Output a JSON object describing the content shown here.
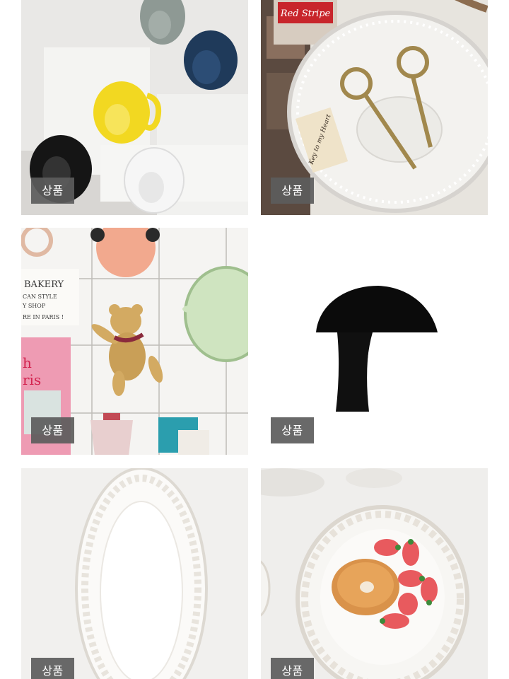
{
  "grid": {
    "items": [
      {
        "badge": "상품",
        "image": "david-head-mugs"
      },
      {
        "badge": "상품",
        "image": "glass-bowl-vintage-keys",
        "image_text": [
          "Red Stripe",
          "Key to my Heart"
        ]
      },
      {
        "badge": "상품",
        "image": "kitchen-wall-bear-hook",
        "image_text": [
          "BAKERY",
          "CAN STYLE",
          "Y SHOP",
          "RE IN PARIS !",
          "h",
          "ris"
        ]
      },
      {
        "badge": "상품",
        "image": "black-mushroom-lamp"
      },
      {
        "badge": "상품",
        "image": "white-oval-embossed-platter"
      },
      {
        "badge": "상품",
        "image": "baroque-plate-bagel-strawberries"
      }
    ]
  },
  "colors": {
    "badge_bg": "#5c5c5c",
    "badge_text": "#ffffff",
    "page_bg": "#ffffff"
  }
}
